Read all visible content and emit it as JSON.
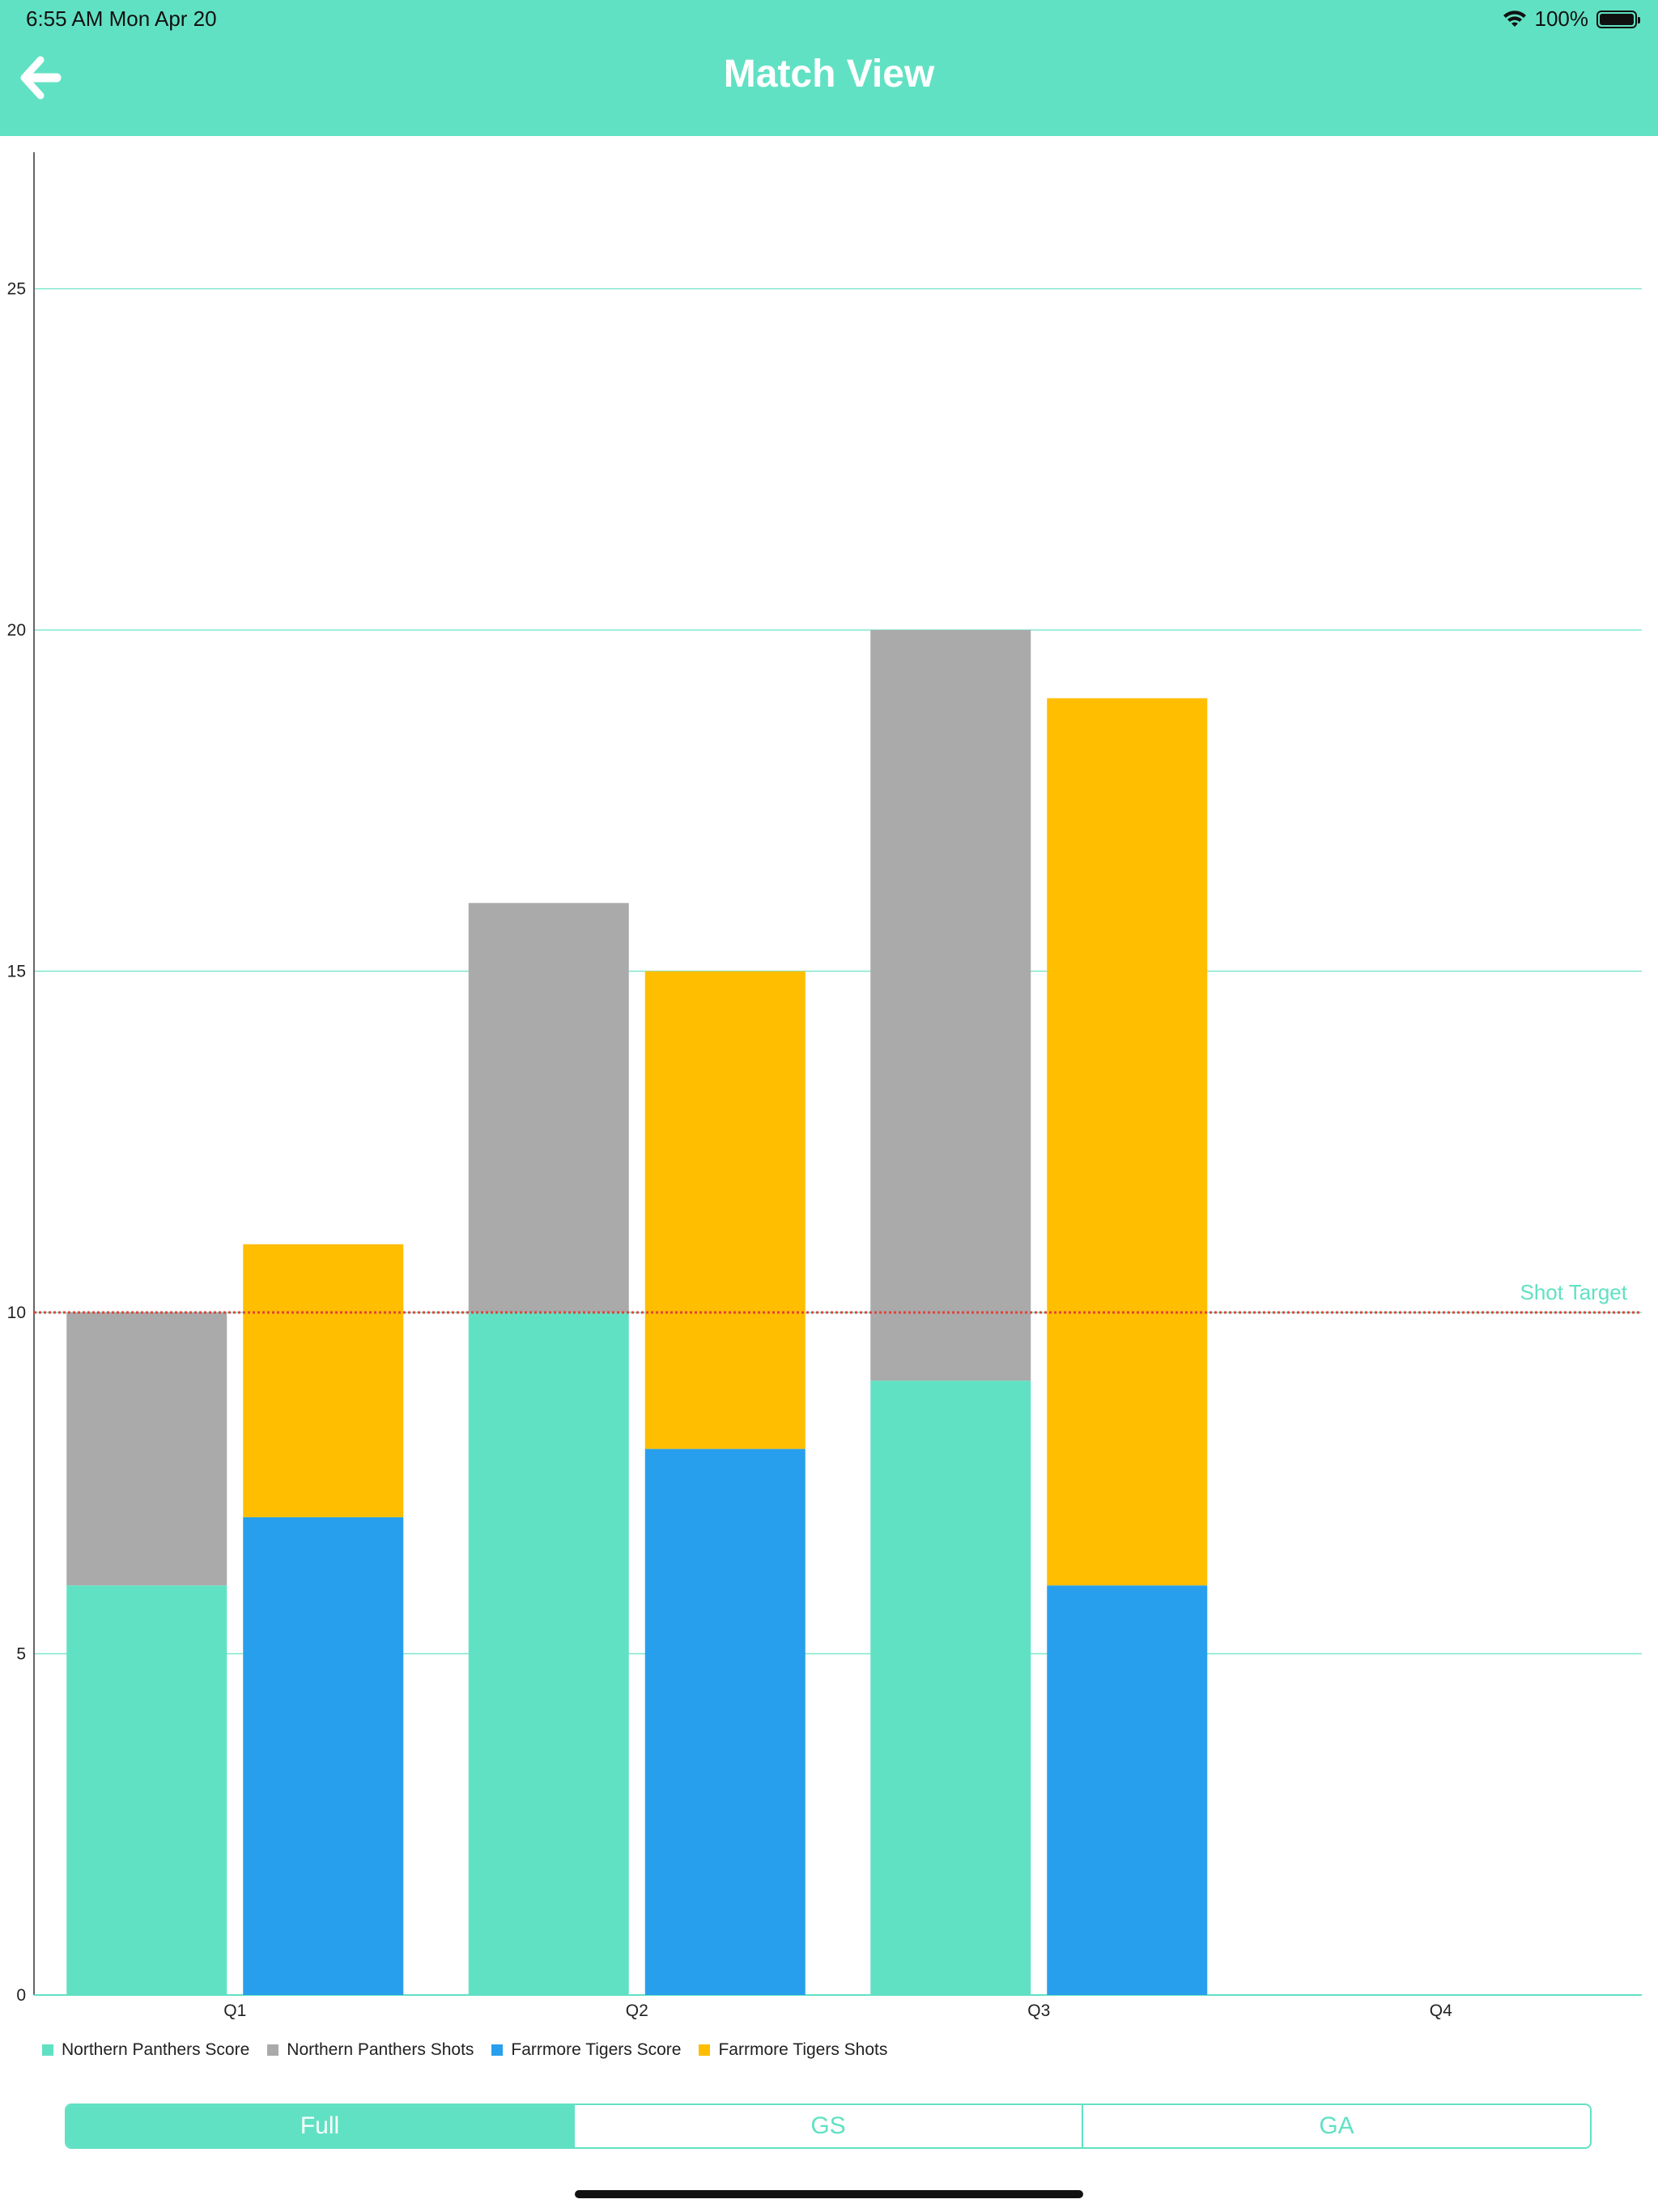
{
  "status_bar": {
    "time": "6:55 AM   Mon Apr 20",
    "battery": "100%"
  },
  "header": {
    "title": "Match View",
    "back_icon": "arrow-left-icon"
  },
  "chart_data": {
    "type": "bar",
    "stacked_groups": true,
    "categories": [
      "Q1",
      "Q2",
      "Q3",
      "Q4"
    ],
    "ylim": [
      0,
      27
    ],
    "y_ticks": [
      0,
      5,
      10,
      15,
      20,
      25
    ],
    "grid": true,
    "series": [
      {
        "name": "Northern Panthers Score",
        "team": "Northern Panthers",
        "kind": "score",
        "values": [
          6,
          10,
          9,
          0
        ],
        "color": "#61E1C3"
      },
      {
        "name": "Northern Panthers Shots",
        "team": "Northern Panthers",
        "kind": "shots",
        "values": [
          10,
          16,
          20,
          0
        ],
        "color": "#AAAAAA"
      },
      {
        "name": "Farrmore Tigers Score",
        "team": "Farrmore Tigers",
        "kind": "score",
        "values": [
          7,
          8,
          6,
          0
        ],
        "color": "#289FEC"
      },
      {
        "name": "Farrmore Tigers Shots",
        "team": "Farrmore Tigers",
        "kind": "shots",
        "values": [
          11,
          15,
          19,
          0
        ],
        "color": "#FFBE00"
      }
    ],
    "reference_line": {
      "label": "Shot Target",
      "value": 10,
      "color": "#E0433B",
      "label_color": "#61E1C3"
    },
    "legend_position": "bottom-left"
  },
  "legend": [
    {
      "label": "Northern Panthers Score",
      "color": "#61E1C3"
    },
    {
      "label": "Northern Panthers Shots",
      "color": "#AAAAAA"
    },
    {
      "label": "Farrmore Tigers Score",
      "color": "#289FEC"
    },
    {
      "label": "Farrmore Tigers Shots",
      "color": "#FFBE00"
    }
  ],
  "segmented_control": {
    "options": [
      "Full",
      "GS",
      "GA"
    ],
    "selected": "Full"
  },
  "colors": {
    "accent": "#61E1C3",
    "grid": "#61E1C3",
    "axis": "#666666"
  }
}
